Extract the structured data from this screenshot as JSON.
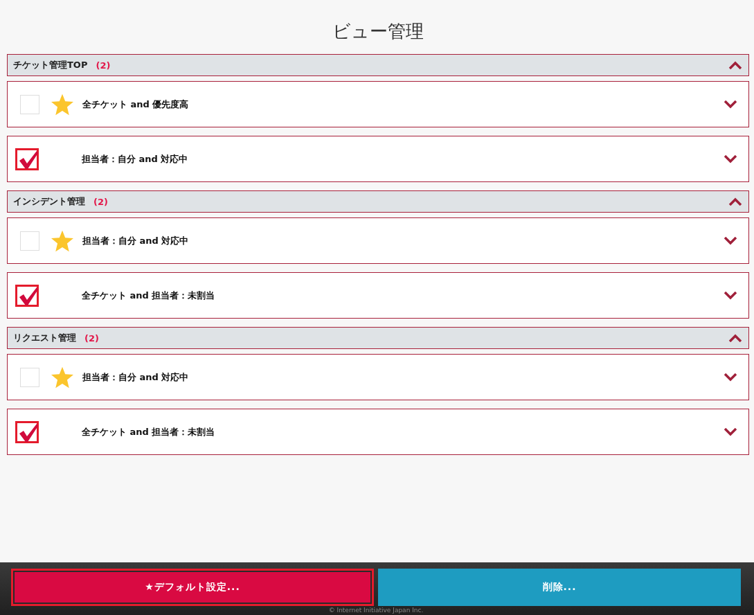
{
  "title": "ビュー管理",
  "groups": [
    {
      "name": "チケット管理TOP",
      "count": "(2)",
      "expanded": true,
      "views": [
        {
          "label": "全チケット and 優先度高",
          "checked": false,
          "default": true,
          "expanded": false
        },
        {
          "label": "担当者：自分 and 対応中",
          "checked": true,
          "default": false,
          "expanded": false
        }
      ]
    },
    {
      "name": "インシデント管理",
      "count": "(2)",
      "expanded": true,
      "views": [
        {
          "label": "担当者：自分 and 対応中",
          "checked": false,
          "default": true,
          "expanded": false
        },
        {
          "label": "全チケット and 担当者：未割当",
          "checked": true,
          "default": false,
          "expanded": false
        }
      ]
    },
    {
      "name": "リクエスト管理",
      "count": "(2)",
      "expanded": true,
      "views": [
        {
          "label": "担当者：自分 and 対応中",
          "checked": false,
          "default": true,
          "expanded": false
        },
        {
          "label": "全チケット and 担当者：未割当",
          "checked": true,
          "default": false,
          "expanded": false
        }
      ]
    }
  ],
  "buttons": [
    {
      "label": "★デフォルト設定...",
      "kind": "primary",
      "focused": true
    },
    {
      "label": "削除...",
      "kind": "secondary",
      "focused": false
    }
  ],
  "footer": "© Internet Initiative Japan Inc."
}
